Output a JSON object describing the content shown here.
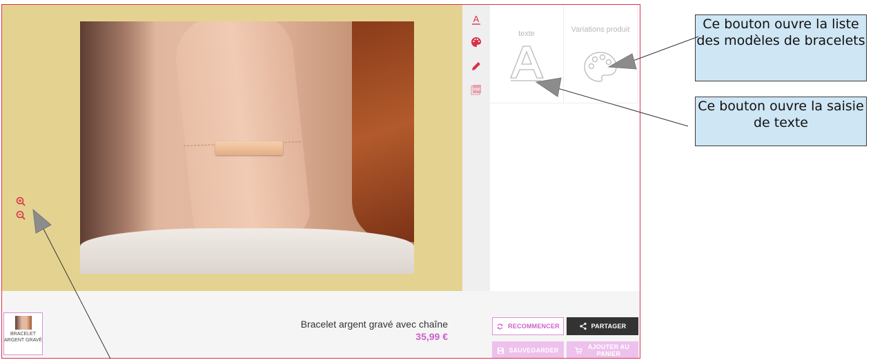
{
  "tools": {
    "text_icon": "text-tool-icon",
    "palette_icon": "palette-icon",
    "pencil_icon": "pencil-icon",
    "pdf_icon": "pdf-icon"
  },
  "panel": {
    "tiles": [
      {
        "label": "texte",
        "icon": "letter-a-outline-icon"
      },
      {
        "label": "Variations produit",
        "icon": "palette-outline-icon"
      }
    ]
  },
  "product": {
    "thumb_label": "BRACELET ARGENT GRAVÉ",
    "name": "Bracelet argent gravé avec chaîne",
    "price": "35,99 €"
  },
  "buttons": {
    "restart": "RECOMMENCER",
    "share": "PARTAGER",
    "save": "SAUVEGARDER",
    "add_to_cart": "AJOUTER AU PANIER"
  },
  "annotations": {
    "callout_models": "Ce bouton ouvre la liste des modèles de bracelets",
    "callout_text": "Ce bouton ouvre la saisie de texte"
  },
  "colors": {
    "accent": "#d8314a",
    "brand_pink": "#d05ecb",
    "stage_bg": "#e4d390",
    "callout_bg": "#cfe6f4",
    "share_bg": "#333333"
  }
}
